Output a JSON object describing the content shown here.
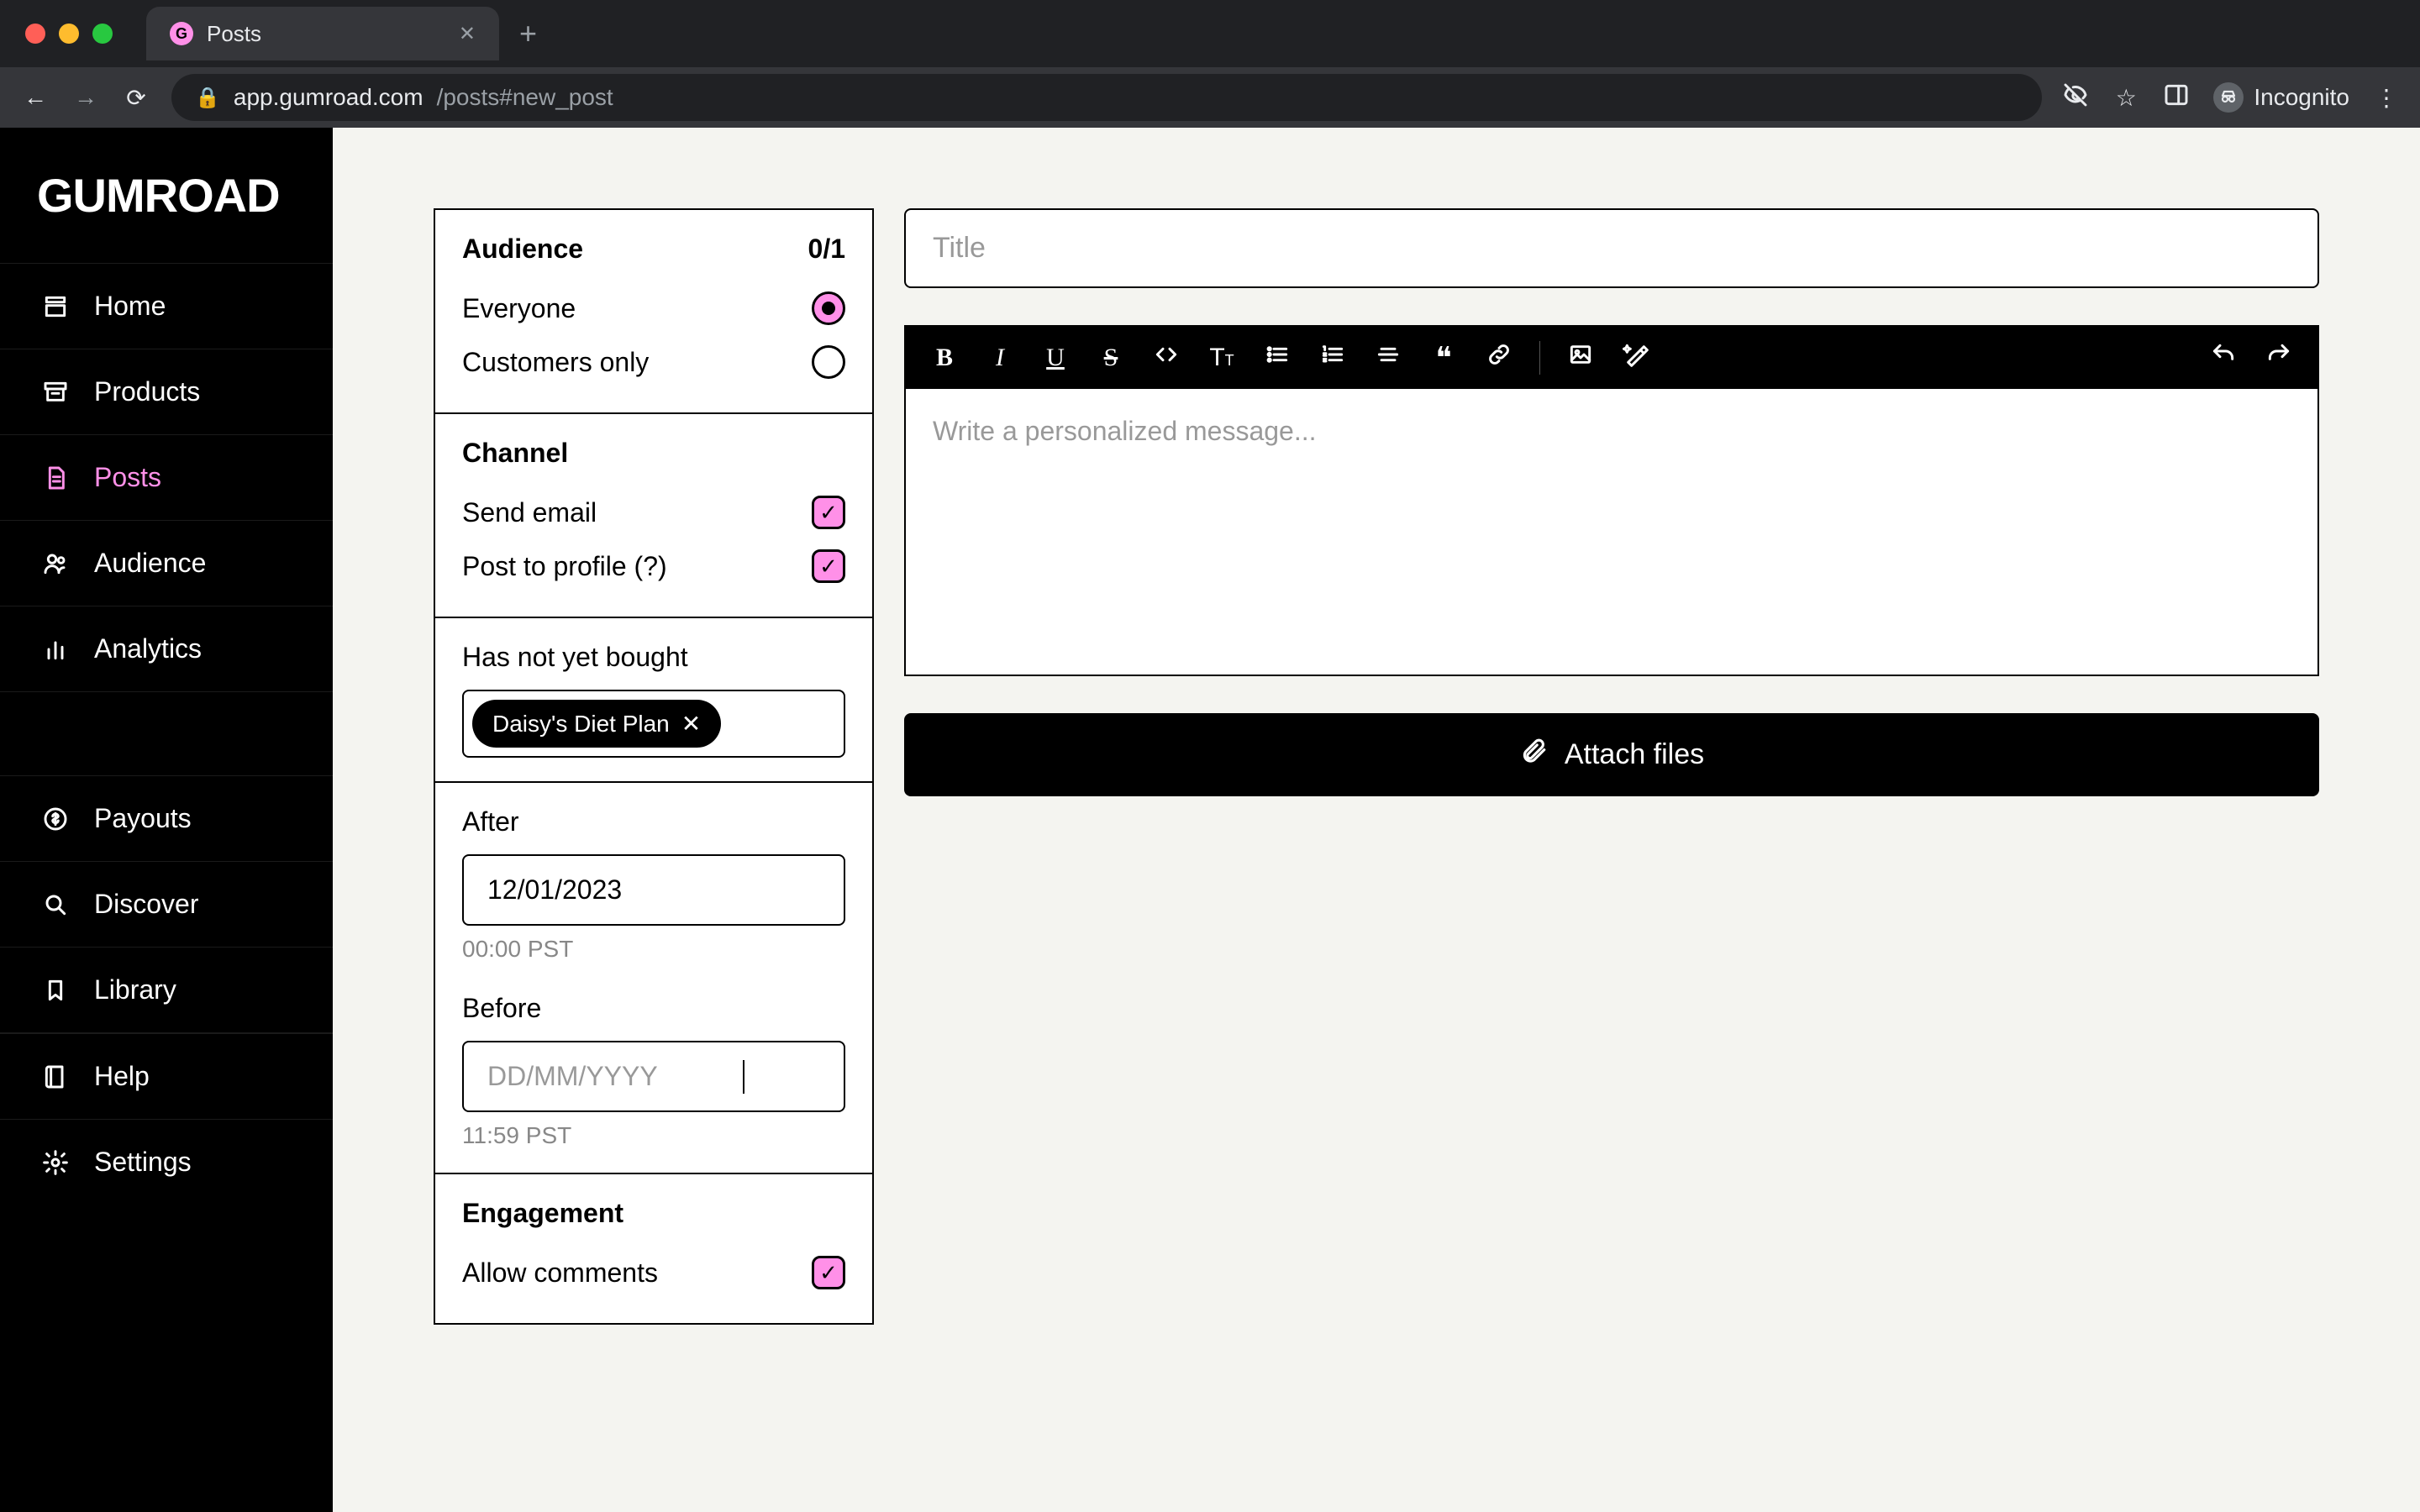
{
  "browser": {
    "tab_title": "Posts",
    "url_domain": "app.gumroad.com",
    "url_path": "/posts#new_post",
    "profile_label": "Incognito"
  },
  "sidebar": {
    "logo": "GUMROAD",
    "items": [
      {
        "label": "Home"
      },
      {
        "label": "Products"
      },
      {
        "label": "Posts"
      },
      {
        "label": "Audience"
      },
      {
        "label": "Analytics"
      }
    ],
    "lower": [
      {
        "label": "Payouts"
      },
      {
        "label": "Discover"
      },
      {
        "label": "Library"
      }
    ],
    "footer": [
      {
        "label": "Help"
      },
      {
        "label": "Settings"
      }
    ]
  },
  "config": {
    "audience": {
      "title": "Audience",
      "count": "0/1",
      "everyone": "Everyone",
      "customers_only": "Customers only"
    },
    "channel": {
      "title": "Channel",
      "send_email": "Send email",
      "post_to_profile": "Post to profile  (?)"
    },
    "not_bought": {
      "title": "Has not yet bought",
      "tag": "Daisy's Diet Plan"
    },
    "after": {
      "title": "After",
      "value": "12/01/2023",
      "hint": "00:00 PST"
    },
    "before": {
      "title": "Before",
      "placeholder": "DD/MM/YYYY",
      "hint": "11:59 PST"
    },
    "engagement": {
      "title": "Engagement",
      "allow_comments": "Allow comments"
    }
  },
  "editor": {
    "title_placeholder": "Title",
    "body_placeholder": "Write a personalized message...",
    "attach_label": "Attach files"
  }
}
